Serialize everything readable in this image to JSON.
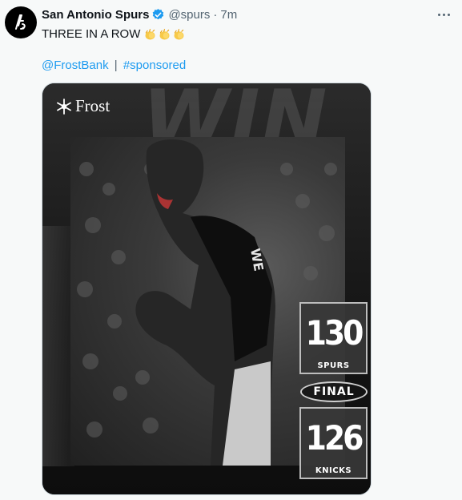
{
  "tweet": {
    "author_name": "San Antonio Spurs",
    "handle": "@spurs",
    "separator": "·",
    "time": "7m",
    "text": "THREE IN A ROW",
    "link_handle": "@FrostBank",
    "link_sep": "|",
    "hashtag": "#sponsored"
  },
  "media": {
    "sponsor_logo": "Frost",
    "headline_bg": "WIN",
    "scores": {
      "home_score": "130",
      "home_team": "SPURS",
      "status": "FINAL",
      "away_score": "126",
      "away_team": "KNICKS"
    },
    "jersey_text": "WE"
  },
  "icons": {
    "verified": "verified-badge-icon",
    "more": "more-options-icon",
    "emoji": "clapping-hands-emoji"
  },
  "colors": {
    "link": "#1d9bf0",
    "verified": "#1d9bf0",
    "muted": "#536471"
  }
}
